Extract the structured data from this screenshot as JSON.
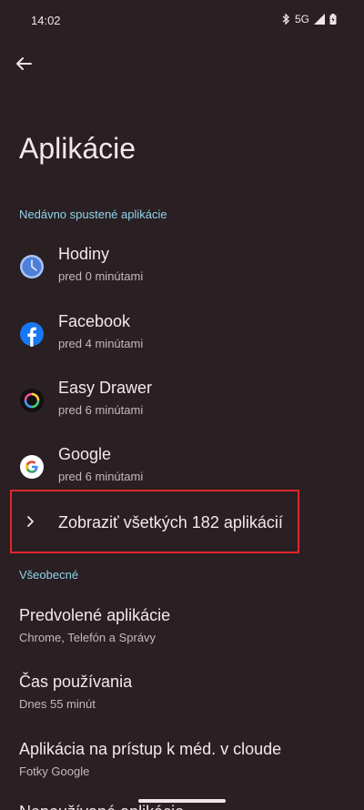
{
  "status": {
    "time": "14:02",
    "network": "5G"
  },
  "page": {
    "title": "Aplikácie"
  },
  "recent": {
    "header": "Nedávno spustené aplikácie",
    "apps": [
      {
        "name": "Hodiny",
        "time": "pred 0 minútami",
        "icon": "clock-icon"
      },
      {
        "name": "Facebook",
        "time": "pred 4 minútami",
        "icon": "facebook-icon"
      },
      {
        "name": "Easy Drawer",
        "time": "pred 6 minútami",
        "icon": "easy-drawer-icon"
      },
      {
        "name": "Google",
        "time": "pred 6 minútami",
        "icon": "google-icon"
      }
    ],
    "show_all": "Zobraziť všetkých 182 aplikácií"
  },
  "general": {
    "header": "Všeobecné",
    "items": [
      {
        "title": "Predvolené aplikácie",
        "subtitle": "Chrome, Telefón a Správy"
      },
      {
        "title": "Čas používania",
        "subtitle": "Dnes 55 minút"
      },
      {
        "title": "Aplikácia na prístup k méd. v cloude",
        "subtitle": "Fotky Google"
      }
    ],
    "cut_item": "Nepoužívané aplikácie"
  },
  "colors": {
    "background": "#2a1f23",
    "accent": "#8ed4ea",
    "highlight": "#e0262a"
  }
}
